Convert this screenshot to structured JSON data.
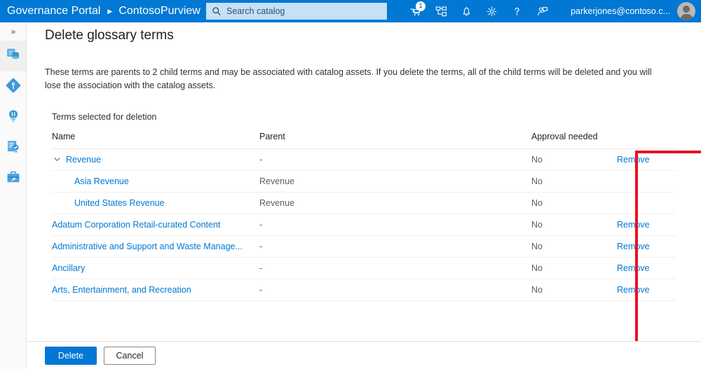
{
  "header": {
    "brand": "Governance Portal",
    "separator_icon": "chevron-right-icon",
    "account_name": "ContosoPurview",
    "search": {
      "icon": "search-icon",
      "placeholder": "Search catalog",
      "value": ""
    },
    "icons": [
      {
        "name": "cart-icon",
        "badge": "1"
      },
      {
        "name": "share-network-icon",
        "badge": ""
      },
      {
        "name": "bell-icon",
        "badge": ""
      },
      {
        "name": "gear-icon",
        "badge": ""
      },
      {
        "name": "help-icon",
        "badge": ""
      },
      {
        "name": "feedback-icon",
        "badge": ""
      }
    ],
    "user": {
      "email": "parkerjones@contoso.c...",
      "avatar_icon": "avatar-icon"
    }
  },
  "sidebar": {
    "expand_icon": "double-chevron-right-icon",
    "expand_label": "»",
    "items": [
      {
        "name": "sidebar-item-data-sources",
        "icon": "database-icon"
      },
      {
        "name": "sidebar-item-data-map",
        "icon": "data-map-icon"
      },
      {
        "name": "sidebar-item-insights",
        "icon": "lightbulb-icon"
      },
      {
        "name": "sidebar-item-glossary",
        "icon": "certificate-icon"
      },
      {
        "name": "sidebar-item-management",
        "icon": "toolbox-icon"
      }
    ]
  },
  "main": {
    "title": "Delete glossary terms",
    "description": "These terms are parents to 2 child terms and may be associated with catalog assets. If you delete the terms, all of the child terms will be deleted and you will lose the association with the catalog assets.",
    "table_caption": "Terms selected for deletion",
    "columns": {
      "name": "Name",
      "parent": "Parent",
      "approval": "Approval needed",
      "actions": ""
    },
    "rows": [
      {
        "name": "Revenue",
        "parent": "-",
        "approval": "No",
        "action": "Remove",
        "child": false,
        "expandable": true,
        "expand_icon": "chevron-down-icon"
      },
      {
        "name": "Asia Revenue",
        "parent": "Revenue",
        "approval": "No",
        "action": "",
        "child": true,
        "expandable": false,
        "expand_icon": ""
      },
      {
        "name": "United States Revenue",
        "parent": "Revenue",
        "approval": "No",
        "action": "",
        "child": true,
        "expandable": false,
        "expand_icon": ""
      },
      {
        "name": "Adatum Corporation Retail-curated Content",
        "parent": "-",
        "approval": "No",
        "action": "Remove",
        "child": false,
        "expandable": false,
        "expand_icon": ""
      },
      {
        "name": "Administrative and Support and Waste Manage...",
        "parent": "-",
        "approval": "No",
        "action": "Remove",
        "child": false,
        "expandable": false,
        "expand_icon": ""
      },
      {
        "name": "Ancillary",
        "parent": "-",
        "approval": "No",
        "action": "Remove",
        "child": false,
        "expandable": false,
        "expand_icon": ""
      },
      {
        "name": "Arts, Entertainment, and Recreation",
        "parent": "-",
        "approval": "No",
        "action": "Remove",
        "child": false,
        "expandable": false,
        "expand_icon": ""
      }
    ]
  },
  "footer": {
    "delete_label": "Delete",
    "cancel_label": "Cancel"
  },
  "annotation": {
    "name": "red-highlight-box",
    "color": "#e81123"
  },
  "colors": {
    "header_blue": "#0078d4",
    "link_blue": "#0078d4",
    "search_bg": "#c7e0f4",
    "annotation_red": "#e81123",
    "page_bg": "#f3f2f1"
  }
}
